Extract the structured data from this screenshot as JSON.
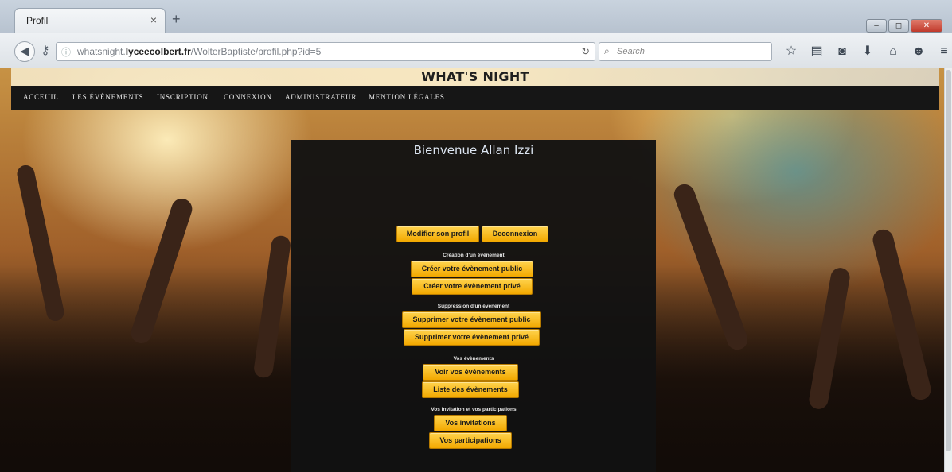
{
  "browser": {
    "tab_title": "Profil",
    "tab_close": "×",
    "new_tab": "+",
    "url_prefix": "whatsnight.",
    "url_domain": "lyceecolbert.fr",
    "url_path": "/WolterBaptiste/profil.php?id=5",
    "search_placeholder": "Search"
  },
  "site": {
    "title": "WHAT'S NIGHT",
    "menu": [
      {
        "label": "ACCEUIL"
      },
      {
        "label": "LES ÉVÉNEMENTS"
      },
      {
        "label": "INSCRIPTION"
      },
      {
        "label": "CONNEXION"
      },
      {
        "label": "ADMINISTRATEUR"
      },
      {
        "label": "MENTION LÉGALES"
      }
    ]
  },
  "profile": {
    "welcome": "Bienvenue Allan Izzi",
    "edit_profile": "Modifier son profil",
    "logout": "Deconnexion",
    "create_section": "Création d'un évènement",
    "create_public": "Créer votre évènement public",
    "create_private": "Créer votre évènement privé",
    "delete_section": "Suppression d'un évènement",
    "delete_public": "Supprimer votre évènement public",
    "delete_private": "Supprimer votre évènement privé",
    "events_section": "Vos évènements",
    "see_events": "Voir vos évènements",
    "events_list": "Liste des évènements",
    "invites_section": "Vos invitation et vos participations",
    "invitations": "Vos invitations",
    "participations": "Vos participations"
  },
  "colors": {
    "button": "#f7bd18",
    "menu_bg": "#161616",
    "panel_bg": "#121212"
  }
}
